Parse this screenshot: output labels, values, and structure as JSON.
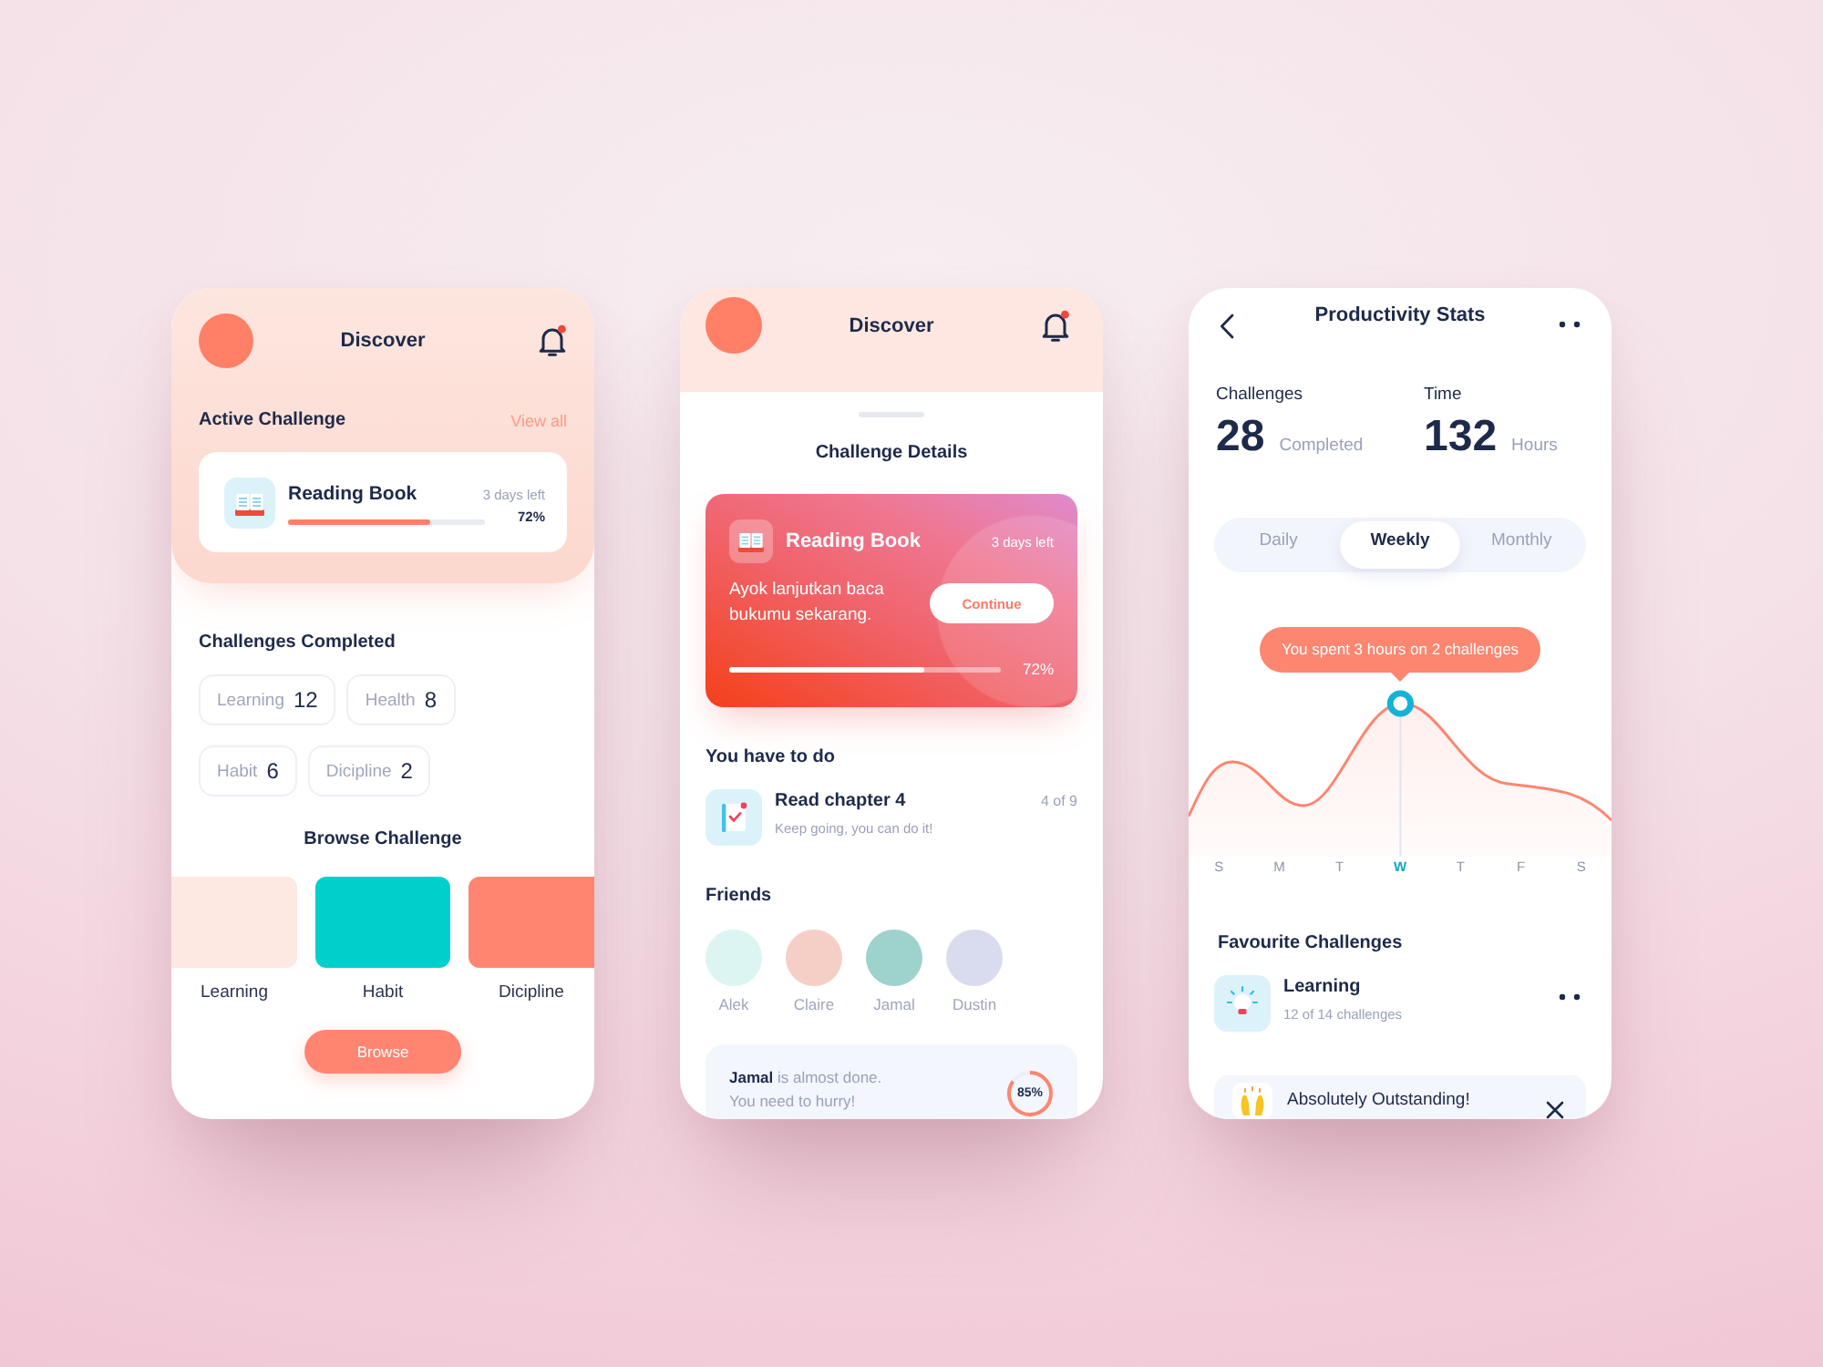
{
  "discover_screen": {
    "header": {
      "title": "Discover",
      "notification": true
    },
    "active_challenge": {
      "heading": "Active Challenge",
      "link": "View all",
      "card": {
        "title": "Reading Book",
        "time_left": "3 days left",
        "level": 0.72,
        "percent": "72%"
      }
    },
    "completed": {
      "heading": "Challenges Completed",
      "chip_rows": [
        [
          {
            "label": "Learning",
            "count": "12"
          },
          {
            "label": "Health",
            "count": "8"
          }
        ],
        [
          {
            "label": "Habit",
            "count": "6"
          },
          {
            "label": "Dicipline",
            "count": "2"
          }
        ]
      ]
    },
    "browse": {
      "heading": "Browse Challenge",
      "tiles": [
        {
          "label": "Learning",
          "color": "#fde8e2"
        },
        {
          "label": "Habit",
          "color": "#00d0cc"
        },
        {
          "label": "Dicipline",
          "color": "#ff8570"
        }
      ],
      "button": "Browse"
    }
  },
  "details_screen": {
    "header": {
      "title": "Discover",
      "notification": true
    },
    "heading": "Challenge Details",
    "card": {
      "title": "Reading Book",
      "time_left": "3 days left",
      "message": "Ayok lanjutkan baca bukumu sekarang.",
      "button": "Continue",
      "level": 0.72,
      "percent": "72%"
    },
    "todo": {
      "heading": "You have to do",
      "task": {
        "title": "Read chapter 4",
        "subtitle": "Keep going, you can do it!",
        "count": "4 of 9"
      }
    },
    "friends": {
      "heading": "Friends",
      "items": [
        {
          "name": "Alek",
          "color": "#dcf4f2"
        },
        {
          "name": "Claire",
          "color": "#f5cfc5"
        },
        {
          "name": "Jamal",
          "color": "#9ed2cd"
        },
        {
          "name": "Dustin",
          "color": "#d9dbef"
        }
      ]
    },
    "notice": {
      "lines": [
        "**Jamal** is almost done.",
        "You need to hurry!"
      ],
      "level": 0.85,
      "percent": "85%"
    }
  },
  "stats_screen": {
    "title": "Productivity Stats",
    "stats": [
      {
        "label": "Challenges",
        "value": "28",
        "unit": "Completed"
      },
      {
        "label": "Time",
        "value": "132",
        "unit": "Hours"
      }
    ],
    "periods": [
      {
        "label": "Daily",
        "selected": false
      },
      {
        "label": "Weekly",
        "selected": true
      },
      {
        "label": "Monthly",
        "selected": false
      }
    ],
    "chart": {
      "tooltip": "You spent 3 hours on 2 challenges",
      "days": [
        {
          "label": "S",
          "selected": false
        },
        {
          "label": "M",
          "selected": false
        },
        {
          "label": "T",
          "selected": false
        },
        {
          "label": "W",
          "selected": true
        },
        {
          "label": "T",
          "selected": false
        },
        {
          "label": "F",
          "selected": false
        },
        {
          "label": "S",
          "selected": false
        }
      ]
    },
    "favourites": {
      "heading": "Favourite Challenges",
      "items": [
        {
          "title": "Learning",
          "subtitle": "12 of 14 challenges"
        }
      ]
    },
    "toast": {
      "text": "Absolutely Outstanding!"
    }
  }
}
